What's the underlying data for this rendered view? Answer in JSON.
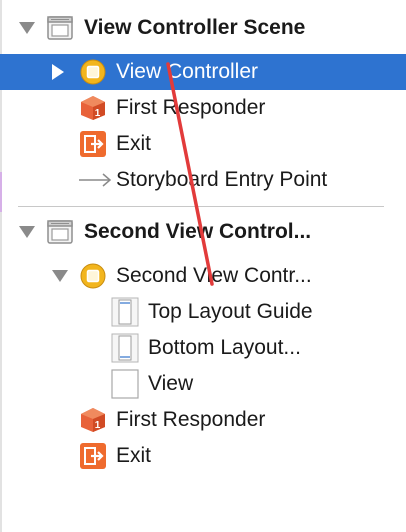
{
  "outline": {
    "scene1": {
      "title": "View Controller Scene",
      "view_controller": "View Controller",
      "first_responder": "First Responder",
      "exit": "Exit",
      "entry_point": "Storyboard Entry Point"
    },
    "scene2": {
      "title": "Second View Control...",
      "view_controller": "Second View Contr...",
      "top_layout_guide": "Top Layout Guide",
      "bottom_layout_guide": "Bottom Layout...",
      "view": "View",
      "first_responder": "First Responder",
      "exit": "Exit"
    }
  },
  "colors": {
    "selection": "#2e73d0",
    "annotation_arrow": "#e23b3b",
    "exit_icon": "#ef6b2e",
    "first_responder_icon": "#e8623a",
    "view_controller_icon": "#f2b51d"
  }
}
